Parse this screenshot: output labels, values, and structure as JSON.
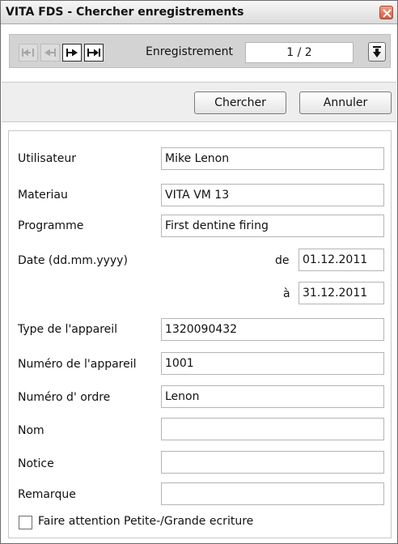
{
  "window": {
    "title": "VITA FDS - Chercher enregistrements"
  },
  "navigator": {
    "record_label": "Enregistrement",
    "record_value": "1 / 2",
    "buttons": [
      {
        "icon": "first-record-icon",
        "enabled": false
      },
      {
        "icon": "previous-record-icon",
        "enabled": false
      },
      {
        "icon": "next-record-icon",
        "enabled": true
      },
      {
        "icon": "last-record-icon",
        "enabled": true
      }
    ]
  },
  "actions": {
    "search_label": "Chercher",
    "cancel_label": "Annuler"
  },
  "form": {
    "user": {
      "label": "Utilisateur",
      "value": "Mike Lenon"
    },
    "material": {
      "label": "Materiau",
      "value": "VITA VM 13"
    },
    "program": {
      "label": "Programme",
      "value": "First dentine firing"
    },
    "date": {
      "label": "Date (dd.mm.yyyy)",
      "from_label": "de",
      "from_value": "01.12.2011",
      "to_label": "à",
      "to_value": "31.12.2011"
    },
    "device_type": {
      "label": "Type de l'appareil",
      "value": "1320090432"
    },
    "device_number": {
      "label": "Numéro de l'appareil",
      "value": "1001"
    },
    "order_number": {
      "label": "Numéro d' ordre",
      "value": "Lenon"
    },
    "name": {
      "label": "Nom",
      "value": ""
    },
    "notice": {
      "label": "Notice",
      "value": ""
    },
    "remark": {
      "label": "Remarque",
      "value": ""
    },
    "case_sensitive": {
      "label": "Faire attention Petite-/Grande ecriture",
      "checked": false
    }
  },
  "colors": {
    "close_button": "#d8583a",
    "toolbar_bg": "#d3d3d3",
    "button_bar_bg": "#eeeeee"
  }
}
